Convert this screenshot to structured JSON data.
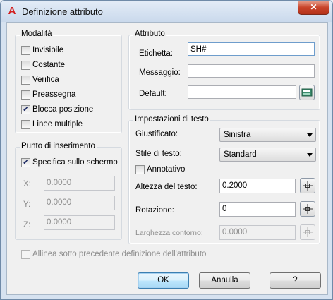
{
  "window": {
    "title": "Definizione attributo",
    "close_glyph": "✕"
  },
  "modalita": {
    "label": "Modalità",
    "items": [
      {
        "label": "Invisibile",
        "checked": false
      },
      {
        "label": "Costante",
        "checked": false
      },
      {
        "label": "Verifica",
        "checked": false
      },
      {
        "label": "Preassegna",
        "checked": false
      },
      {
        "label": "Blocca posizione",
        "checked": true
      },
      {
        "label": "Linee multiple",
        "checked": false
      }
    ]
  },
  "attributo": {
    "label": "Attributo",
    "etichetta_label": "Etichetta:",
    "etichetta_value": "SH#",
    "messaggio_label": "Messaggio:",
    "messaggio_value": "",
    "default_label": "Default:",
    "default_value": ""
  },
  "punto": {
    "label": "Punto di inserimento",
    "specifica_label": "Specifica sullo schermo",
    "specifica_checked": true,
    "x_label": "X:",
    "x_value": "0.0000",
    "y_label": "Y:",
    "y_value": "0.0000",
    "z_label": "Z:",
    "z_value": "0.0000"
  },
  "testo": {
    "label": "Impostazioni di testo",
    "giustificato_label": "Giustificato:",
    "giustificato_value": "Sinistra",
    "stile_label": "Stile di testo:",
    "stile_value": "Standard",
    "annotativo_label": "Annotativo",
    "annotativo_checked": false,
    "altezza_label": "Altezza del testo:",
    "altezza_value": "0.2000",
    "rotazione_label": "Rotazione:",
    "rotazione_value": "0",
    "larghezza_label": "Larghezza contorno:",
    "larghezza_value": "0.0000"
  },
  "allinea_label": "Allinea sotto precedente definizione dell'attributo",
  "buttons": {
    "ok": "OK",
    "annulla": "Annulla",
    "help": "?"
  },
  "colors": {
    "accent": "#3c7fb1",
    "app_icon": "#d21f1f",
    "close": "#c9442a"
  }
}
